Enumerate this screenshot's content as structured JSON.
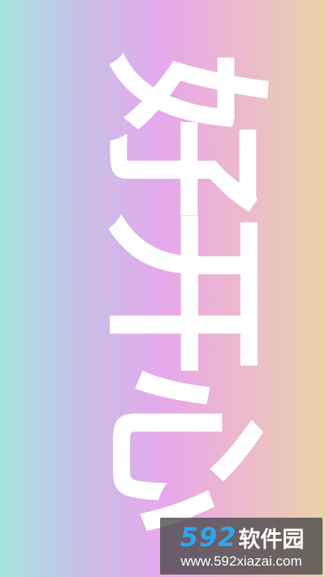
{
  "wallpaper": {
    "text": "好开心",
    "gradient_colors": [
      "#a6e6dc",
      "#c2c4e6",
      "#e6a8ec",
      "#ecb7cf",
      "#e9d3a7"
    ]
  },
  "watermark": {
    "brand_number": "592",
    "brand_text": "软件园",
    "url": "www.592xiazai.com",
    "number_color": "#2aa7f2"
  }
}
